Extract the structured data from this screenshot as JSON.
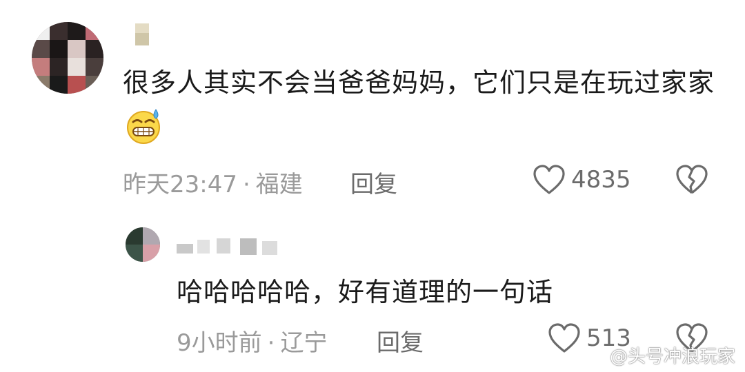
{
  "comments": [
    {
      "text": "很多人其实不会当爸爸妈妈，它们只是在玩过家家",
      "emoji": "cold-sweat-grin-emoji",
      "time": "昨天23:47",
      "location": "福建",
      "reply_label": "回复",
      "likes": "4835"
    },
    {
      "text": "哈哈哈哈哈，好有道理的一句话",
      "time": "9小时前",
      "location": "辽宁",
      "reply_label": "回复",
      "likes": "513"
    }
  ],
  "separator": "·",
  "watermark": "@头号冲浪玩家",
  "icons": {
    "like": "heart-outline-icon",
    "dislike": "broken-heart-icon",
    "watermark": "weibo-logo-icon"
  },
  "colors": {
    "text": "#1a1a1a",
    "meta": "#9a9a9a",
    "action": "#6b6b6b"
  }
}
